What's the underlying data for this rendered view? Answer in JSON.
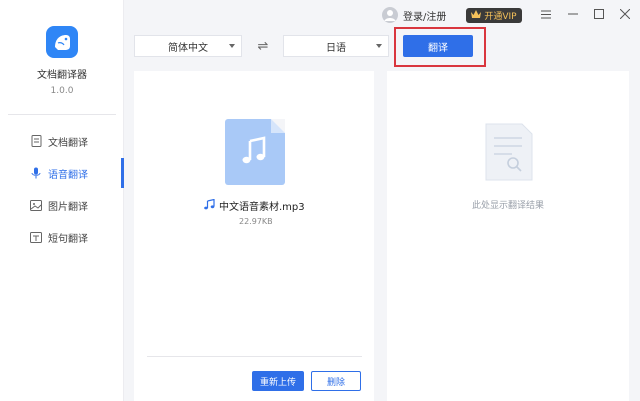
{
  "app": {
    "name": "文档翻译器",
    "version": "1.0.0"
  },
  "sidebar": {
    "items": [
      {
        "label": "文档翻译",
        "icon": "document-icon",
        "active": false
      },
      {
        "label": "语音翻译",
        "icon": "microphone-icon",
        "active": true
      },
      {
        "label": "图片翻译",
        "icon": "image-icon",
        "active": false
      },
      {
        "label": "短句翻译",
        "icon": "text-icon",
        "active": false
      }
    ]
  },
  "header": {
    "login_label": "登录/注册",
    "vip_label": "开通VIP"
  },
  "toolbar": {
    "source_lang": "简体中文",
    "target_lang": "日语",
    "translate_label": "翻译"
  },
  "file": {
    "name": "中文语音素材.mp3",
    "size": "22.97KB"
  },
  "actions": {
    "reupload_label": "重新上传",
    "delete_label": "删除"
  },
  "result": {
    "placeholder": "此处显示翻译结果"
  },
  "colors": {
    "accent": "#2f6fe8",
    "highlight": "#d9363e",
    "vip_bg": "#3a3a3a",
    "vip_text": "#f5c15a"
  }
}
